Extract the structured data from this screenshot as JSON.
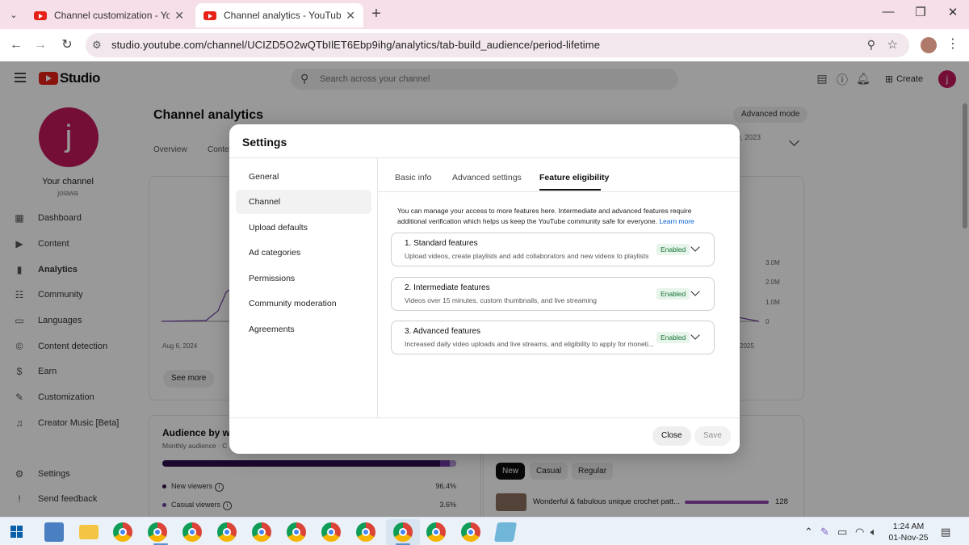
{
  "browser": {
    "tabs": [
      {
        "title": "Channel customization - YouTube Studio",
        "active": false
      },
      {
        "title": "Channel analytics - YouTube Studio",
        "active": true
      }
    ],
    "url": "studio.youtube.com/channel/UCIZD5O2wQTbIlET6Ebp9ihg/analytics/tab-build_audience/period-lifetime"
  },
  "studio": {
    "logo_text": "Studio",
    "search_placeholder": "Search across your channel",
    "create_label": "Create",
    "avatar_letter": "j"
  },
  "sidebar": {
    "channel_label": "Your channel",
    "handle": "joiawa",
    "items": [
      {
        "label": "Dashboard",
        "icon": "dashboard-icon"
      },
      {
        "label": "Content",
        "icon": "content-icon"
      },
      {
        "label": "Analytics",
        "icon": "analytics-icon",
        "active": true
      },
      {
        "label": "Community",
        "icon": "community-icon"
      },
      {
        "label": "Languages",
        "icon": "languages-icon"
      },
      {
        "label": "Content detection",
        "icon": "copyright-icon"
      },
      {
        "label": "Earn",
        "icon": "earn-icon"
      },
      {
        "label": "Customization",
        "icon": "customization-icon"
      },
      {
        "label": "Creator Music [Beta]",
        "icon": "music-icon"
      }
    ],
    "bottom_items": [
      {
        "label": "Settings",
        "icon": "gear-icon"
      },
      {
        "label": "Send feedback",
        "icon": "feedback-icon"
      }
    ]
  },
  "analytics": {
    "title": "Channel analytics",
    "advanced_mode": "Advanced mode",
    "tabs": [
      "Overview",
      "Conte"
    ],
    "date_fragment": "0, 2023",
    "y_ticks": [
      "3.0M",
      "2.0M",
      "1.0M",
      "0"
    ],
    "x_ticks": [
      "Aug 6, 2024",
      "2025"
    ],
    "see_more": "See more",
    "audience": {
      "title": "Audience by wa",
      "subtitle": "Monthly audience · C",
      "rows": [
        {
          "label": "New viewers",
          "pct": "96.4%"
        },
        {
          "label": "Casual viewers",
          "pct": "3.6%"
        }
      ]
    },
    "chips": [
      "New",
      "Casual",
      "Regular"
    ],
    "video": {
      "title": "Wonderful & fabulous unique crochet patt...",
      "count": "128"
    }
  },
  "settings_dialog": {
    "title": "Settings",
    "left_nav": [
      "General",
      "Channel",
      "Upload defaults",
      "Ad categories",
      "Permissions",
      "Community moderation",
      "Agreements"
    ],
    "active_nav": "Channel",
    "tabs": [
      "Basic info",
      "Advanced settings",
      "Feature eligibility"
    ],
    "active_tab": "Feature eligibility",
    "description": "You can manage your access to more features here. Intermediate and advanced features require additional verification which helps us keep the YouTube community safe for everyone.",
    "learn_more": "Learn more",
    "features": [
      {
        "name": "1. Standard features",
        "desc": "Upload videos, create playlists and add collaborators and new videos to playlists",
        "status": "Enabled"
      },
      {
        "name": "2. Intermediate features",
        "desc": "Videos over 15 minutes, custom thumbnails, and live streaming",
        "status": "Enabled"
      },
      {
        "name": "3. Advanced features",
        "desc": "Increased daily video uploads and live streams, and eligibility to apply for moneti...",
        "status": "Enabled"
      }
    ],
    "close_label": "Close",
    "save_label": "Save"
  },
  "taskbar": {
    "time": "1:24 AM",
    "date": "01-Nov-25"
  },
  "colors": {
    "youtube_red": "#e62117",
    "enabled_bg": "#e6f4ea",
    "enabled_text": "#137333",
    "link_blue": "#065fd4",
    "avatar": "#c2185b"
  }
}
